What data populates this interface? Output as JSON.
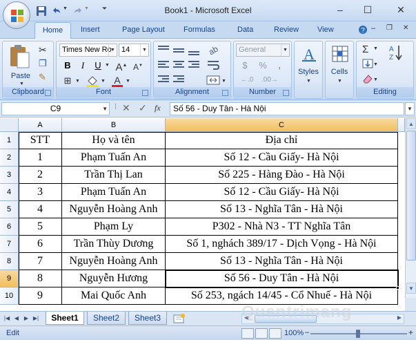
{
  "window": {
    "title": "Book1 - Microsoft Excel",
    "minimize": "–",
    "maximize": "☐",
    "close": "✕"
  },
  "ribbon_tabs": [
    "Home",
    "Insert",
    "Page Layout",
    "Formulas",
    "Data",
    "Review",
    "View"
  ],
  "ribbon": {
    "clipboard": {
      "label": "Clipboard",
      "paste": "Paste"
    },
    "font": {
      "label": "Font",
      "name": "Times New Ro",
      "size": "14",
      "bold": "B",
      "italic": "I",
      "underline": "U"
    },
    "alignment": {
      "label": "Alignment"
    },
    "number": {
      "label": "Number",
      "format": "General",
      "currency": "$",
      "percent": "%",
      "comma": ","
    },
    "styles": {
      "label": "Styles"
    },
    "cells": {
      "label": "Cells"
    },
    "editing": {
      "label": "Editing"
    }
  },
  "formula_bar": {
    "name_box": "C9",
    "fx": "fx",
    "value": "Số 56 - Duy Tân - Hà Nội"
  },
  "columns": [
    "A",
    "B",
    "C"
  ],
  "rows": [
    {
      "num": "1",
      "a": "STT",
      "b": "Họ và tên",
      "c": "Địa chỉ"
    },
    {
      "num": "2",
      "a": "1",
      "b": "Phạm Tuấn An",
      "c": "Số 12 - Cầu Giấy- Hà Nội"
    },
    {
      "num": "3",
      "a": "2",
      "b": "Trần Thị Lan",
      "c": "Số 225 - Hàng Đào - Hà Nội"
    },
    {
      "num": "4",
      "a": "3",
      "b": "Phạm Tuấn An",
      "c": "Số 12 - Cầu Giấy- Hà Nội"
    },
    {
      "num": "5",
      "a": "4",
      "b": "Nguyễn Hoàng Anh",
      "c": "Số 13 - Nghĩa Tân - Hà Nội"
    },
    {
      "num": "6",
      "a": "5",
      "b": "Phạm Ly",
      "c": "P302 - Nhà N3 - TT Nghĩa Tân"
    },
    {
      "num": "7",
      "a": "6",
      "b": "Trần Thùy Dương",
      "c": "Số 1, nghách 389/17 - Dịch Vọng - Hà Nội"
    },
    {
      "num": "8",
      "a": "7",
      "b": "Nguyễn Hoàng Anh",
      "c": "Số 13 - Nghĩa Tân - Hà Nội"
    },
    {
      "num": "9",
      "a": "8",
      "b": "Nguyễn Hương",
      "c": "Số 56 - Duy Tân - Hà Nội"
    },
    {
      "num": "10",
      "a": "9",
      "b": "Mai Quốc Anh",
      "c": "Số 253, ngách 14/45 - Cổ Nhuế - Hà Nội"
    }
  ],
  "sheet_tabs": [
    "Sheet1",
    "Sheet2",
    "Sheet3"
  ],
  "status": {
    "mode": "Edit",
    "zoom": "100%"
  },
  "watermark": "Quantrimang"
}
